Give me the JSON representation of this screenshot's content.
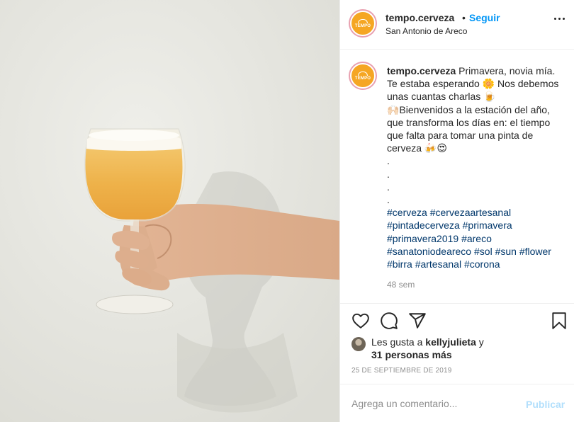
{
  "post": {
    "username": "tempo.cerveza",
    "separator": "•",
    "follow_label": "Seguir",
    "location": "San Antonio de Areco",
    "avatar_text": "TEMPO"
  },
  "caption": {
    "username": "tempo.cerveza",
    "lines": [
      "Primavera, novia mía.",
      "Te estaba esperando 🌼 Nos debemos",
      "unas cuantas charlas 🍺",
      "🙌🏻Bienvenidos a la estación del año,",
      "que transforma los días en: el tiempo",
      "que falta para tomar una pinta de",
      "cerveza 🍻😍",
      ".",
      ".",
      ".",
      "."
    ],
    "hashtag_lines": [
      [
        "#cerveza",
        "#cervezaartesanal"
      ],
      [
        "#pintadecerveza",
        "#primavera"
      ],
      [
        "#primavera2019",
        "#areco"
      ],
      [
        "#sanatoniodeareco",
        "#sol",
        "#sun",
        "#flower"
      ],
      [
        "#birra",
        "#artesanal",
        "#corona"
      ]
    ],
    "time": "48 sem"
  },
  "actions": {
    "icons": [
      "heart-icon",
      "comment-icon",
      "share-icon",
      "bookmark-icon"
    ]
  },
  "likes": {
    "prefix": "Les gusta a",
    "user": "kellyjulieta",
    "conjunction": "y",
    "others": "31 personas más"
  },
  "date": "25 DE SEPTIEMBRE DE 2019",
  "comment": {
    "placeholder": "Agrega un comentario...",
    "post_label": "Publicar"
  },
  "colors": {
    "link": "#0095f6",
    "hashtag": "#00376b",
    "muted": "#8e8e8e",
    "publish_disabled": "#b2dffc",
    "avatar_bg": "#f5a623"
  }
}
